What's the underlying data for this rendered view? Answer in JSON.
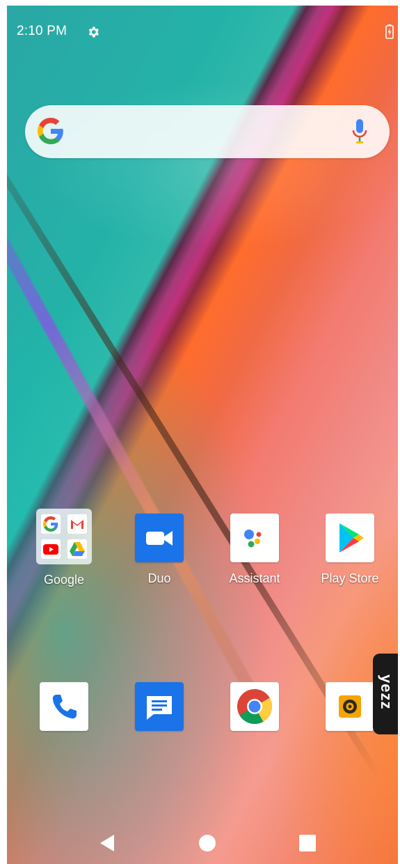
{
  "status_bar": {
    "time": "2:10 PM",
    "settings_icon": "gear-icon",
    "battery_icon": "battery-charging-icon"
  },
  "search": {
    "logo_icon": "google-g-icon",
    "mic_icon": "microphone-icon"
  },
  "apps": {
    "google_folder": {
      "label": "Google",
      "contents": [
        "Google",
        "Gmail",
        "YouTube",
        "Drive"
      ]
    },
    "duo": {
      "label": "Duo"
    },
    "assistant": {
      "label": "Assistant"
    },
    "play_store": {
      "label": "Play Store"
    }
  },
  "dock": {
    "phone_icon": "phone-icon",
    "messages_icon": "messages-icon",
    "chrome_icon": "chrome-icon",
    "camera_icon": "camera-icon"
  },
  "side_badge": {
    "text": "yezz"
  },
  "nav": {
    "back_icon": "back-triangle-icon",
    "home_icon": "home-circle-icon",
    "recents_icon": "recents-square-icon"
  },
  "colors": {
    "google_blue": "#4285F4",
    "google_red": "#EA4335",
    "google_yellow": "#FBBC05",
    "google_green": "#34A853",
    "duo_blue": "#1A73E8"
  }
}
